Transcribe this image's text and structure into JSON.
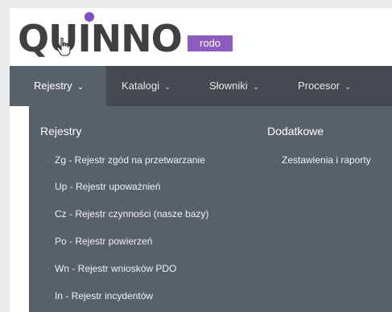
{
  "logo": {
    "wordmark": "QUINNO",
    "badge": "rodo"
  },
  "nav": {
    "items": [
      {
        "label": "Rejestry"
      },
      {
        "label": "Katalogi"
      },
      {
        "label": "Słowniki"
      },
      {
        "label": "Procesor"
      }
    ],
    "active_index": 0
  },
  "dropdown": {
    "left_column": {
      "title": "Rejestry",
      "links": [
        "Zg - Rejestr zgód na przetwarzanie",
        "Up - Rejestr upoważnień",
        "Cz - Rejestr czynności (nasze bazy)",
        "Po - Rejestr powierzeń",
        "Wn - Rejestr wniosków PDO",
        "In - Rejestr incydentów"
      ]
    },
    "right_column": {
      "title": "Dodatkowe",
      "links": [
        "Zestawienia i raporty"
      ]
    }
  },
  "colors": {
    "navbar": "#454a50",
    "active_nav": "#586069",
    "badge": "#8e5bbf",
    "logo_dot": "#7f4fc9"
  },
  "icons": {
    "chevron": "chevron-down-icon",
    "cursor": "hand-pointer-icon"
  }
}
